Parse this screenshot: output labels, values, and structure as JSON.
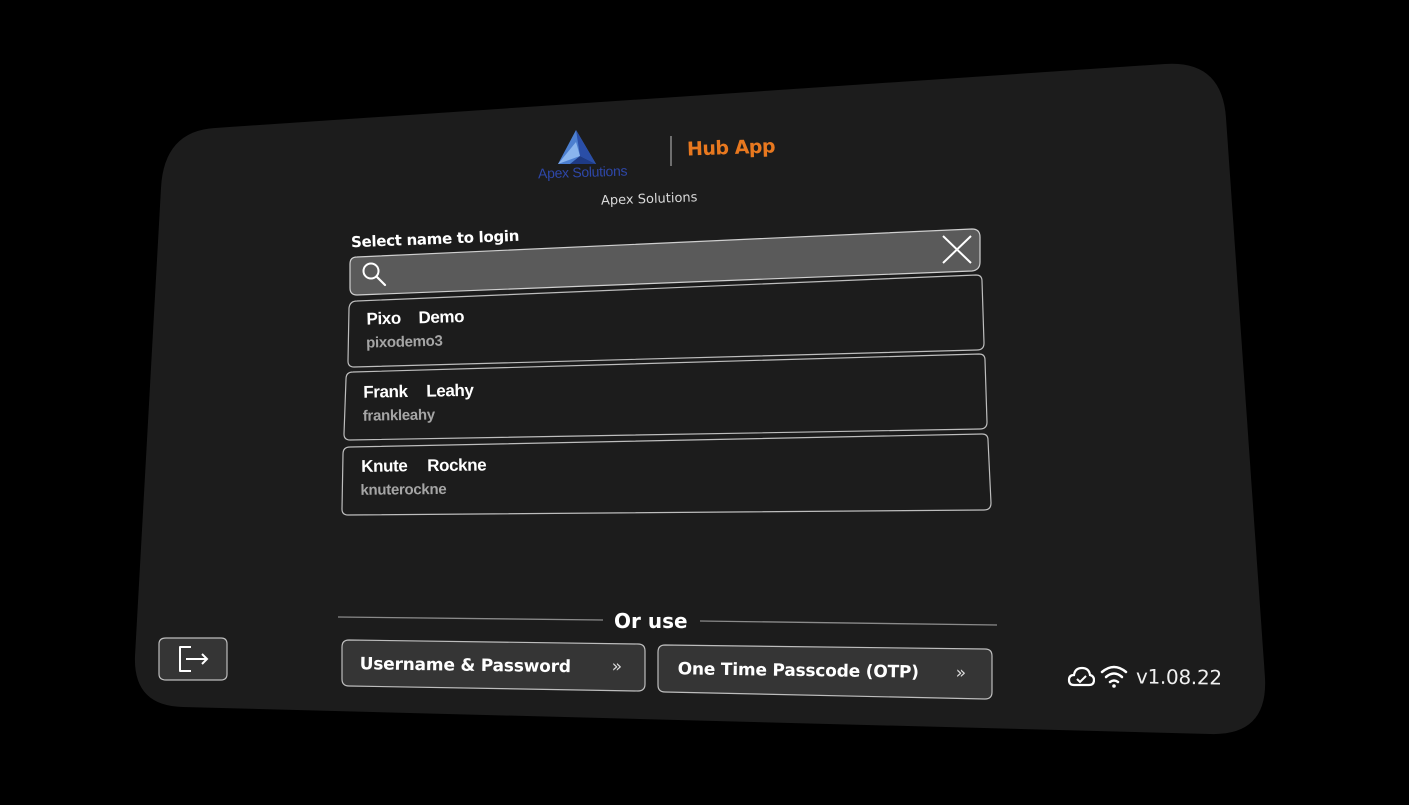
{
  "header": {
    "logo_text": "Apex Solutions",
    "app_name": "Hub App",
    "org_name": "Apex Solutions"
  },
  "login": {
    "select_label": "Select name to login",
    "search": {
      "value": "",
      "placeholder": ""
    },
    "users": [
      {
        "first": "Pixo",
        "last": "Demo",
        "username": "pixodemo3"
      },
      {
        "first": "Frank",
        "last": "Leahy",
        "username": "frankleahy"
      },
      {
        "first": "Knute",
        "last": "Rockne",
        "username": "knuterockne"
      }
    ]
  },
  "alternatives": {
    "heading": "Or use",
    "username_password_label": "Username & Password",
    "otp_label": "One Time Passcode (OTP)"
  },
  "status": {
    "version": "v1.08.22",
    "icons": [
      "cloud-sync-icon",
      "wifi-icon"
    ]
  },
  "icons": {
    "search": "search-icon",
    "clear": "close-icon",
    "exit": "logout-icon",
    "chevron": "double-chevron-right-icon"
  },
  "colors": {
    "panel": "#1c1c1c",
    "accent": "#e8781f",
    "logo": "#2e47a8",
    "search_bg": "#5a5a5a"
  }
}
